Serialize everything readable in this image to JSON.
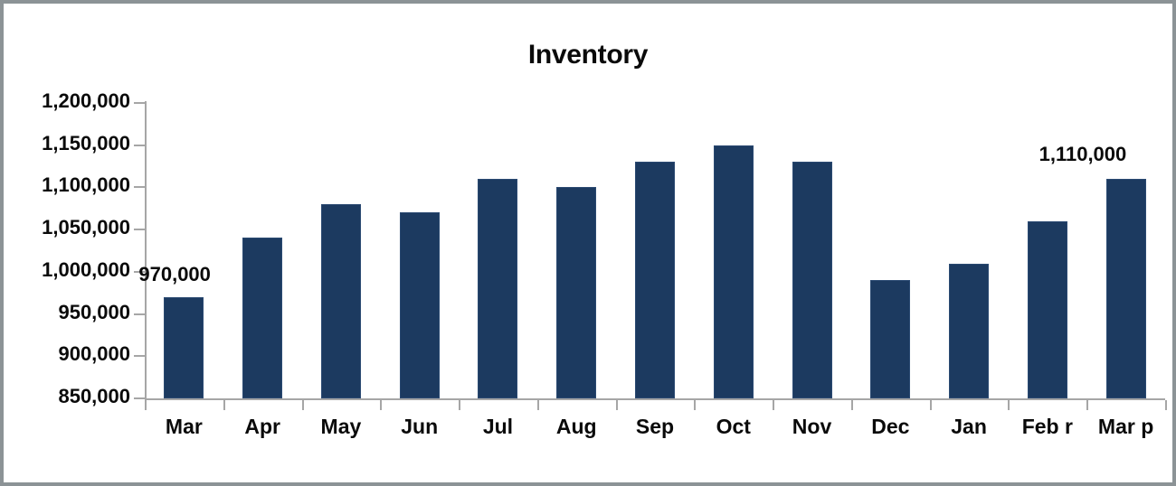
{
  "chart_data": {
    "type": "bar",
    "title": "Inventory",
    "xlabel": "",
    "ylabel": "",
    "categories": [
      "Mar",
      "Apr",
      "May",
      "Jun",
      "Jul",
      "Aug",
      "Sep",
      "Oct",
      "Nov",
      "Dec",
      "Jan",
      "Feb r",
      "Mar p"
    ],
    "values": [
      970000,
      1040000,
      1080000,
      1070000,
      1110000,
      1100000,
      1130000,
      1150000,
      1130000,
      990000,
      1010000,
      1060000,
      1110000
    ],
    "ylim": [
      850000,
      1200000
    ],
    "ytick_values": [
      1200000,
      1150000,
      1100000,
      1050000,
      1000000,
      950000,
      900000,
      850000
    ],
    "ytick_labels": [
      "1,200,000",
      "1,150,000",
      "1,100,000",
      "1,050,000",
      "1,000,000",
      "950,000",
      "900,000",
      "850,000"
    ],
    "grid": false,
    "legend": "none",
    "bar_color": "#1c3a60",
    "axis_color": "#a6a6a6",
    "data_labels": [
      {
        "category": "Mar",
        "text": "970,000"
      },
      {
        "category": "Mar p",
        "text": "1,110,000"
      }
    ]
  },
  "series_color": "#1c3a60"
}
